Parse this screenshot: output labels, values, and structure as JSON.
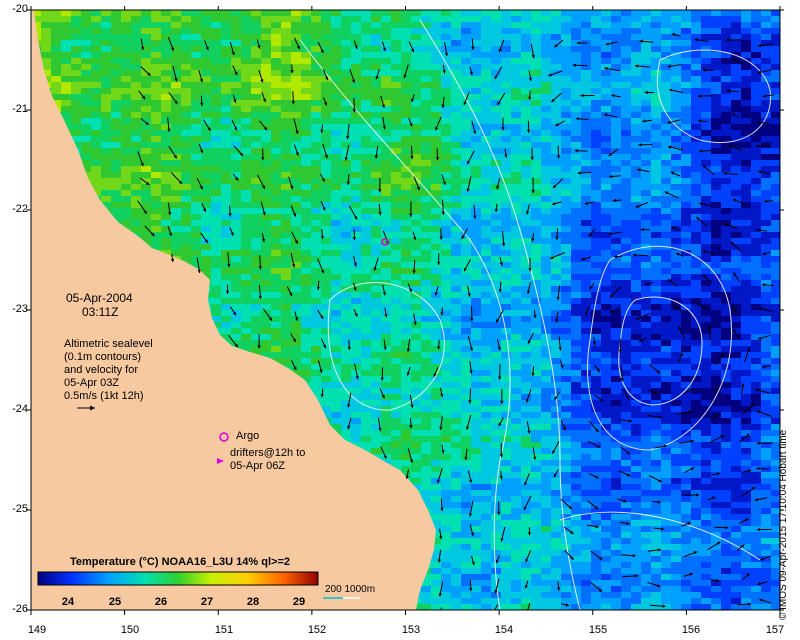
{
  "date_label": "05-Apr-2004",
  "time_label": "03:11Z",
  "altimetry_lines": [
    "Altimetric sealevel",
    "(0.1m contours)",
    "and velocity for",
    "05-Apr 03Z",
    "0.5m/s (1kt 12h)"
  ],
  "argo_label": "Argo",
  "drifter_lines": [
    "drifters@12h to",
    "05-Apr 06Z"
  ],
  "colorbar": {
    "title": "Temperature (°C) NOAA16_L3U 14% ql>=2",
    "ticks": [
      "24",
      "25",
      "26",
      "27",
      "28",
      "29"
    ]
  },
  "depth_label": "200  1000m",
  "credit": "© IMOS 09-Apr-2015 17:10:04 Hobart time",
  "axes": {
    "lon_ticks": [
      "149",
      "150",
      "151",
      "152",
      "153",
      "154",
      "155",
      "156",
      "157"
    ],
    "lat_ticks": [
      "-20",
      "-21",
      "-22",
      "-23",
      "-24",
      "-25",
      "-26"
    ],
    "lon_range": [
      149,
      157
    ],
    "lat_range": [
      -26,
      -20
    ]
  },
  "colors": {
    "land": "#f6c9a0",
    "argo": "#e000e0",
    "contour": "#ffffff",
    "depth_200": "#00c0d0",
    "arrow": "#000000"
  }
}
